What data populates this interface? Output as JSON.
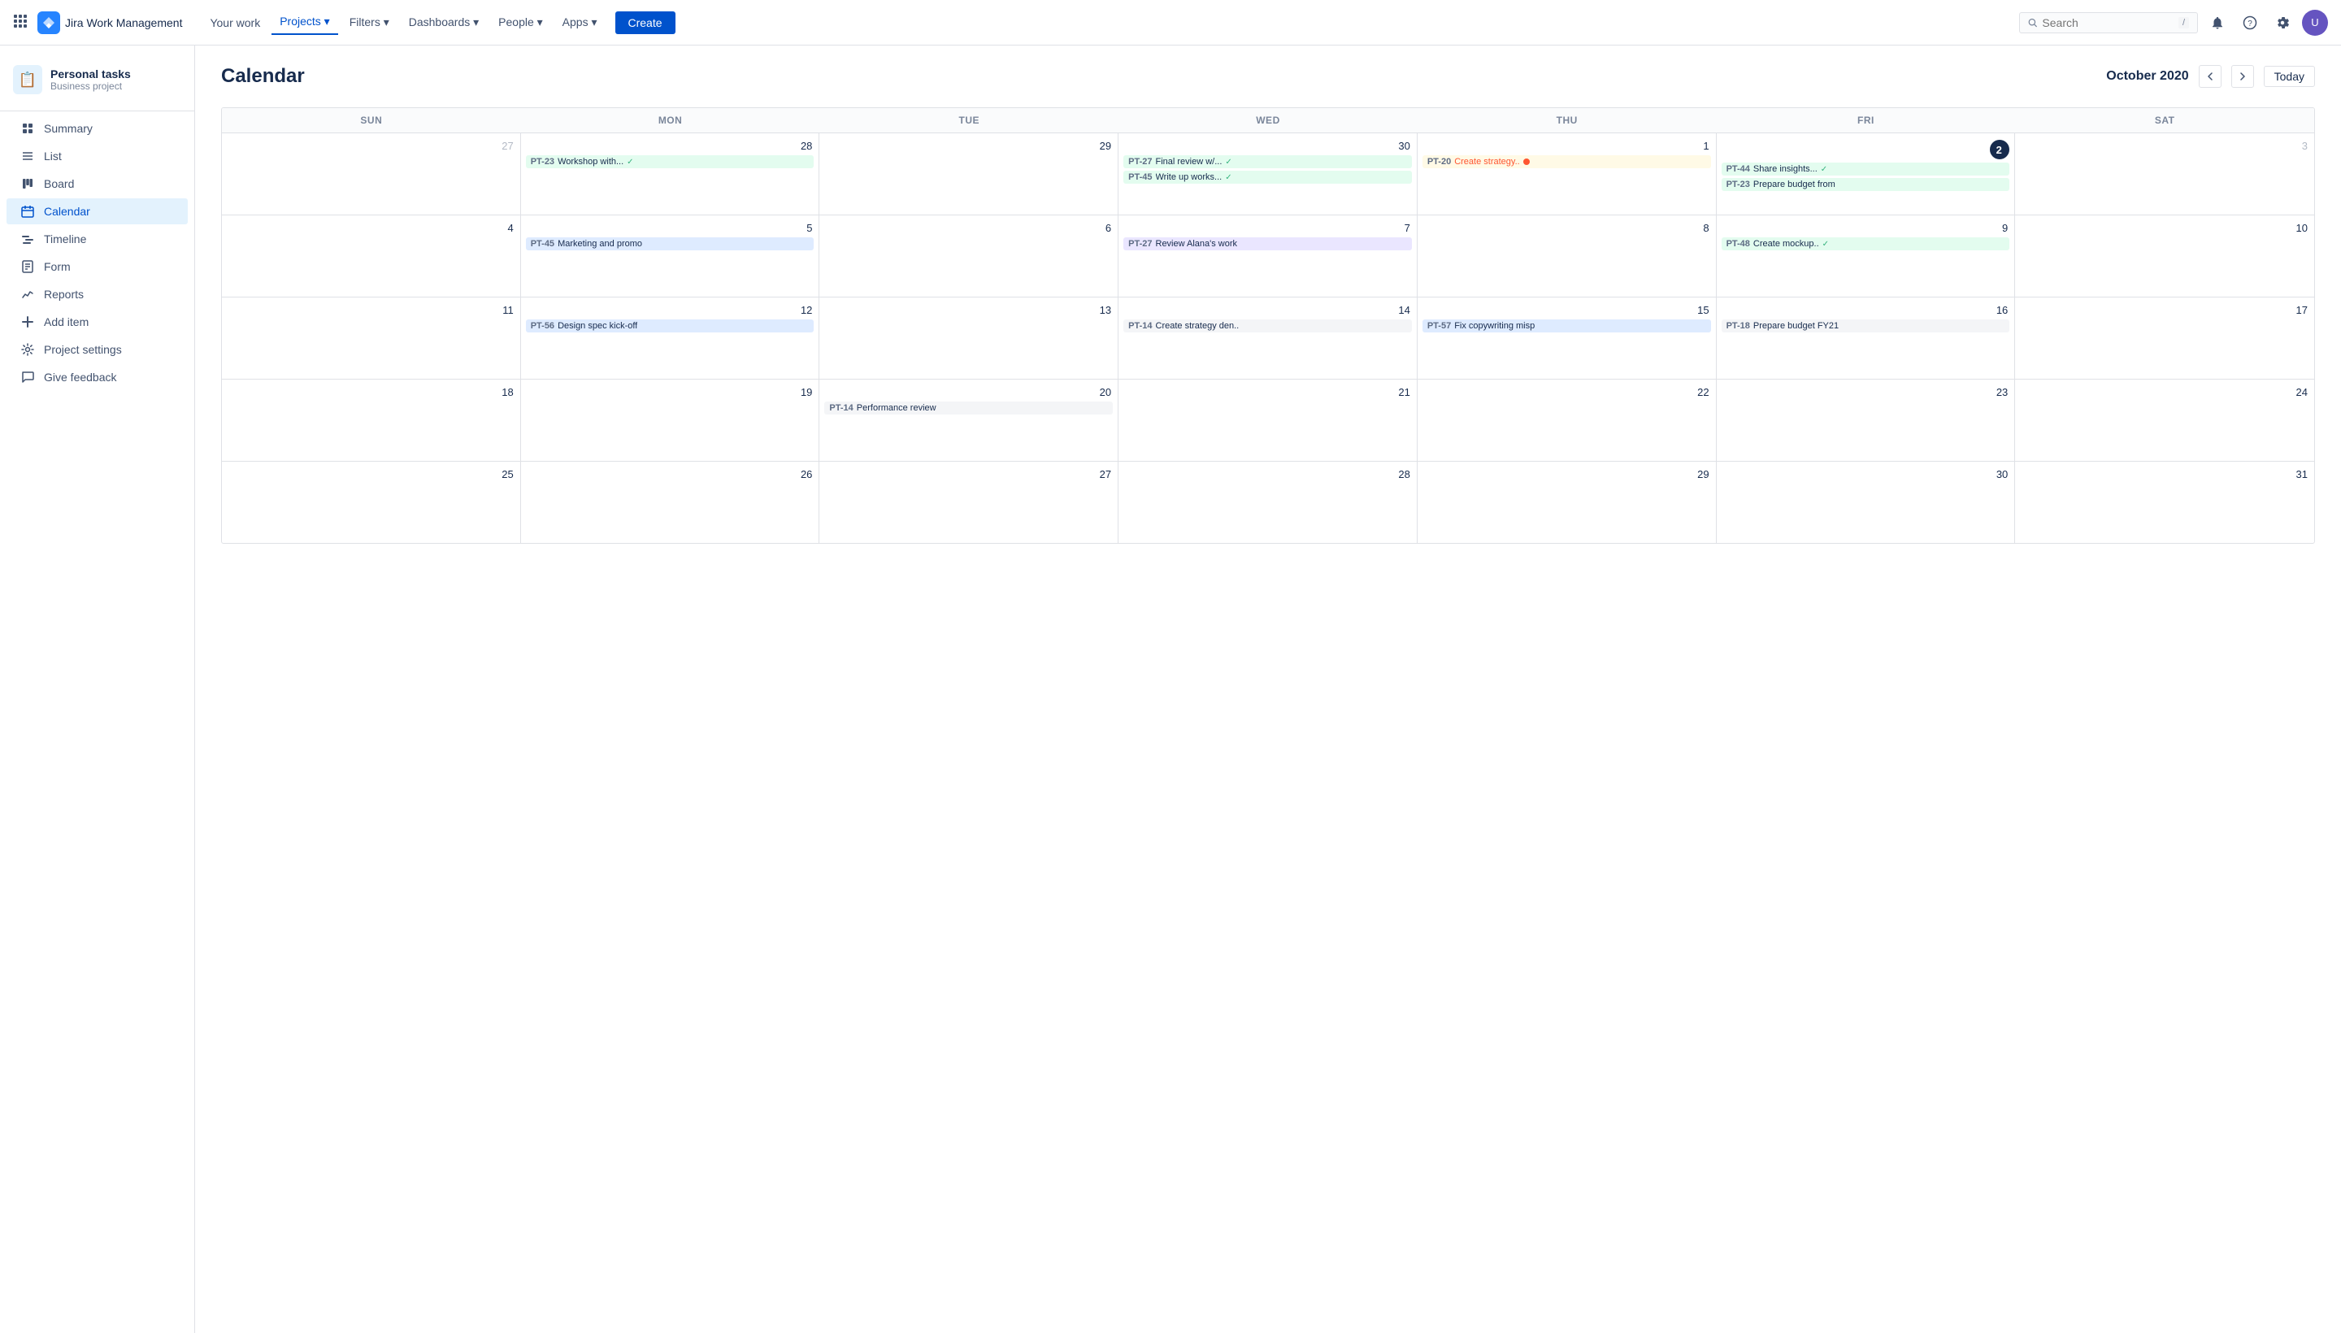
{
  "topnav": {
    "logo_text": "Jira Work Management",
    "nav_items": [
      {
        "label": "Your work",
        "active": false
      },
      {
        "label": "Projects",
        "active": true
      },
      {
        "label": "Filters",
        "active": false
      },
      {
        "label": "Dashboards",
        "active": false
      },
      {
        "label": "People",
        "active": false
      },
      {
        "label": "Apps",
        "active": false
      }
    ],
    "create_label": "Create",
    "search_placeholder": "Search",
    "search_shortcut": "/"
  },
  "sidebar": {
    "project_name": "Personal tasks",
    "project_type": "Business project",
    "items": [
      {
        "id": "summary",
        "label": "Summary",
        "icon": "☰"
      },
      {
        "id": "list",
        "label": "List",
        "icon": "≡"
      },
      {
        "id": "board",
        "label": "Board",
        "icon": "⊞"
      },
      {
        "id": "calendar",
        "label": "Calendar",
        "icon": "▦",
        "active": true
      },
      {
        "id": "timeline",
        "label": "Timeline",
        "icon": "≋"
      },
      {
        "id": "form",
        "label": "Form",
        "icon": "📋"
      },
      {
        "id": "reports",
        "label": "Reports",
        "icon": "📊"
      },
      {
        "id": "add-item",
        "label": "Add item",
        "icon": "＋"
      },
      {
        "id": "project-settings",
        "label": "Project settings",
        "icon": "⚙"
      },
      {
        "id": "give-feedback",
        "label": "Give feedback",
        "icon": "💬"
      }
    ]
  },
  "calendar": {
    "title": "Calendar",
    "month": "October 2020",
    "today_label": "Today",
    "day_headers": [
      "SUN",
      "MON",
      "TUE",
      "WED",
      "THU",
      "FRI",
      "SAT"
    ],
    "weeks": [
      {
        "days": [
          {
            "date": "27",
            "other": true,
            "events": []
          },
          {
            "date": "28",
            "events": [
              {
                "id": "PT-23",
                "name": "Workshop with...",
                "color": "ev-green",
                "check": true
              }
            ]
          },
          {
            "date": "29",
            "events": []
          },
          {
            "date": "30",
            "events": [
              {
                "id": "PT-27",
                "name": "Final review w/...",
                "color": "ev-green",
                "check": true
              },
              {
                "id": "PT-45",
                "name": "Write up works...",
                "color": "ev-green",
                "check": true
              }
            ]
          },
          {
            "date": "1",
            "events": [
              {
                "id": "PT-20",
                "name": "Create strategy..",
                "color": "ev-orange",
                "dot": true,
                "red_name": true
              }
            ]
          },
          {
            "date": "2",
            "today": true,
            "events": [
              {
                "id": "PT-44",
                "name": "Share insights...",
                "color": "ev-green",
                "check": true
              },
              {
                "id": "PT-23",
                "name": "Prepare budget from",
                "color": "ev-green"
              }
            ]
          },
          {
            "date": "3",
            "other": true,
            "events": []
          }
        ]
      },
      {
        "days": [
          {
            "date": "4",
            "events": []
          },
          {
            "date": "5",
            "events": [
              {
                "id": "PT-45",
                "name": "Marketing and promo",
                "color": "ev-blue"
              }
            ]
          },
          {
            "date": "6",
            "events": []
          },
          {
            "date": "7",
            "events": [
              {
                "id": "PT-27",
                "name": "Review Alana's work",
                "color": "ev-purple"
              }
            ]
          },
          {
            "date": "8",
            "events": []
          },
          {
            "date": "9",
            "events": [
              {
                "id": "PT-48",
                "name": "Create mockup..",
                "color": "ev-green",
                "check": true
              }
            ]
          },
          {
            "date": "10",
            "events": []
          }
        ]
      },
      {
        "days": [
          {
            "date": "11",
            "events": []
          },
          {
            "date": "12",
            "events": [
              {
                "id": "PT-56",
                "name": "Design spec kick-off",
                "color": "ev-blue"
              }
            ]
          },
          {
            "date": "13",
            "events": []
          },
          {
            "date": "14",
            "events": [
              {
                "id": "PT-14",
                "name": "Create strategy den..",
                "color": "ev-gray"
              }
            ]
          },
          {
            "date": "15",
            "events": [
              {
                "id": "PT-57",
                "name": "Fix copywriting misp",
                "color": "ev-blue"
              }
            ]
          },
          {
            "date": "16",
            "events": [
              {
                "id": "PT-18",
                "name": "Prepare budget FY21",
                "color": "ev-gray"
              }
            ]
          },
          {
            "date": "17",
            "events": []
          }
        ]
      },
      {
        "days": [
          {
            "date": "18",
            "events": []
          },
          {
            "date": "19",
            "events": []
          },
          {
            "date": "20",
            "events": [
              {
                "id": "PT-14",
                "name": "Performance review",
                "color": "ev-gray"
              }
            ]
          },
          {
            "date": "21",
            "events": []
          },
          {
            "date": "22",
            "events": []
          },
          {
            "date": "23",
            "events": []
          },
          {
            "date": "24",
            "events": []
          }
        ]
      },
      {
        "days": [
          {
            "date": "25",
            "events": []
          },
          {
            "date": "26",
            "events": []
          },
          {
            "date": "27",
            "events": []
          },
          {
            "date": "28",
            "events": []
          },
          {
            "date": "29",
            "events": []
          },
          {
            "date": "30",
            "events": []
          },
          {
            "date": "31",
            "events": []
          }
        ]
      }
    ]
  }
}
